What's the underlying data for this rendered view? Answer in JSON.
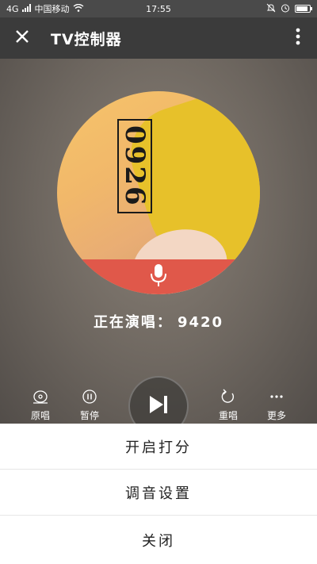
{
  "status_bar": {
    "network": "4G",
    "carrier": "中国移动",
    "time": "17:55",
    "battery_level": 0.85
  },
  "app_bar": {
    "title": "TV控制器",
    "close_icon": "close-icon",
    "more_icon": "more-vertical-icon"
  },
  "player": {
    "album_text": "0926",
    "now_playing_label": "正在演唱：",
    "now_playing_value": "9420",
    "mic_icon": "microphone-icon"
  },
  "controls": {
    "original": "原唱",
    "pause": "暂停",
    "replay": "重唱",
    "more": "更多"
  },
  "sheet": {
    "items": [
      {
        "label": "开启打分"
      },
      {
        "label": "调音设置"
      },
      {
        "label": "关闭"
      }
    ]
  },
  "colors": {
    "app_bar": "#3b3b3b",
    "mic_band": "#e0584a",
    "sheet_bg": "#ffffff"
  }
}
